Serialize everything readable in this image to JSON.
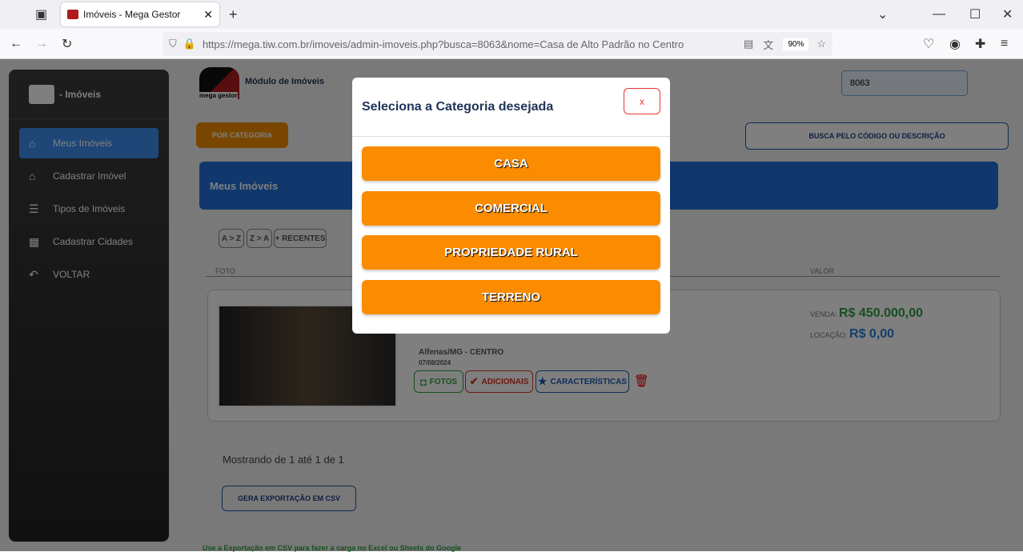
{
  "browser": {
    "tab_title": "Imóveis - Mega Gestor",
    "url": "https://mega.tiw.com.br/imoveis/admin-imoveis.php?busca=8063&nome=Casa de Alto Padrão no Centro",
    "zoom": "90%"
  },
  "sidebar": {
    "logo_text": "- Imóveis",
    "items": [
      {
        "label": "Meus Imóveis",
        "icon": "home-icon"
      },
      {
        "label": "Cadastrar Imóvel",
        "icon": "house-add-icon"
      },
      {
        "label": "Tipos de Imóveis",
        "icon": "checklist-icon"
      },
      {
        "label": "Cadastrar Cidades",
        "icon": "building-icon"
      },
      {
        "label": "VOLTAR",
        "icon": "reply-icon"
      }
    ]
  },
  "header": {
    "module_title": "Módulo de Imóveis",
    "logo_caption": "mega gestor",
    "search_value": "8063"
  },
  "toolbar": {
    "by_category": "POR CATEGORIA",
    "search_by_code": "BUSCA PELO CÓDIGO OU DESCRIÇÃO"
  },
  "panel": {
    "title": "Meus Imóveis",
    "sort": [
      "A > Z",
      "Z > A",
      "+ RECENTES"
    ],
    "columns": {
      "photo": "FOTO",
      "value": "VALOR"
    }
  },
  "listing": {
    "location": "Alfenas/MG - CENTRO",
    "date": "07/08/2024",
    "sale_label": "VENDA:",
    "sale_value": "R$ 450.000,00",
    "rent_label": "LOCAÇÃO:",
    "rent_value": "R$ 0,00",
    "actions": {
      "photos": "FOTOS",
      "extras": "ADICIONAIS",
      "features": "CARACTERÍSTICAS"
    }
  },
  "footer": {
    "showing": "Mostrando de 1 até 1 de 1",
    "export": "GERA EXPORTAÇÃO EM CSV",
    "hint": "Use a Exportação em CSV para fazer a carga no Excel ou Sheets do Google"
  },
  "modal": {
    "title": "Seleciona a Categoria desejada",
    "close": "x",
    "categories": [
      "CASA",
      "COMERCIAL",
      "PROPRIEDADE RURAL",
      "TERRENO"
    ]
  }
}
